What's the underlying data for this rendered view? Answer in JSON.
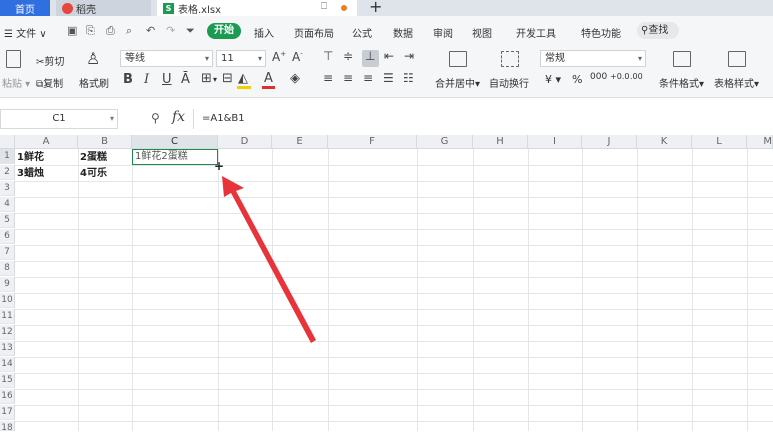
{
  "tabs": {
    "home": "首页",
    "daoke": "稻壳",
    "file": "表格.xlsx"
  },
  "menu": {
    "file": "文件",
    "start": "开始",
    "items": [
      "插入",
      "页面布局",
      "公式",
      "数据",
      "审阅",
      "视图",
      "开发工具",
      "特色功能"
    ],
    "search": "查找"
  },
  "toolbar": {
    "paste": "粘贴",
    "cut": "剪切",
    "copy": "复制",
    "format_painter": "格式刷",
    "font_name": "等线",
    "font_size": "11",
    "bold": "B",
    "italic": "I",
    "underline": "U",
    "merge_center": "合并居中",
    "wrap_text": "自动换行",
    "number_format": "常规",
    "currency": "¥",
    "percent": "%",
    "thousands": "000",
    "inc_decimal": "+0.0",
    "dec_decimal": ".00",
    "conditional_format": "条件格式",
    "table_style": "表格样式"
  },
  "formula_bar": {
    "cell_ref": "C1",
    "fx": "fx",
    "formula": "=A1&B1"
  },
  "sheet": {
    "columns": [
      "A",
      "B",
      "C",
      "D",
      "E",
      "F",
      "G",
      "H",
      "I",
      "J",
      "K",
      "L",
      "M"
    ],
    "rows": [
      "1",
      "2",
      "3",
      "4",
      "5",
      "6",
      "7",
      "8",
      "9",
      "10",
      "11",
      "12",
      "13",
      "14",
      "15",
      "16",
      "17",
      "18"
    ],
    "cells": {
      "A1": "1鲜花",
      "B1": "2蛋糕",
      "C1": "1鲜花2蛋糕",
      "A2": "3蜡烛",
      "B2": "4可乐"
    },
    "fill_handle": "+"
  },
  "colors": {
    "accent_green": "#1b9a52",
    "home_tab_blue": "#2f6fe0",
    "arrow_red": "#e8333a"
  }
}
